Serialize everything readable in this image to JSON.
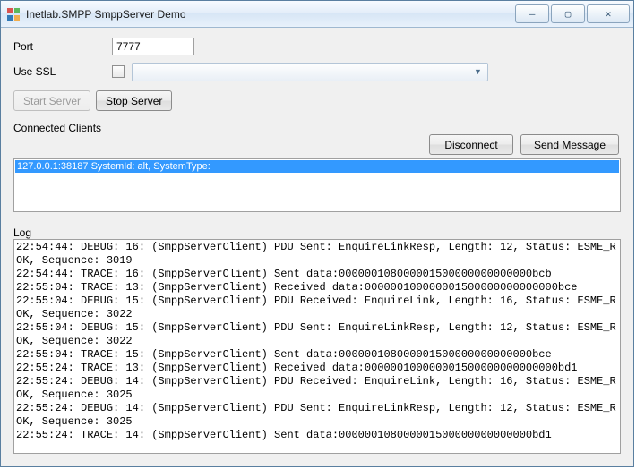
{
  "window": {
    "title": "Inetlab.SMPP SmppServer Demo"
  },
  "form": {
    "portLabel": "Port",
    "portValue": "7777",
    "sslLabel": "Use SSL",
    "sslChecked": false,
    "sslComboValue": ""
  },
  "buttons": {
    "startServer": "Start Server",
    "stopServer": "Stop Server",
    "disconnect": "Disconnect",
    "sendMessage": "Send Message"
  },
  "sections": {
    "connectedClients": "Connected Clients",
    "log": "Log"
  },
  "clients": [
    {
      "text": "127.0.0.1:38187 SystemId: alt, SystemType:",
      "selected": true
    }
  ],
  "logLines": [
    "22:54:44: DEBUG: 16: (SmppServerClient) PDU Sent: EnquireLinkResp, Length: 12, Status: ESME_ROK, Sequence: 3019",
    "22:54:44: TRACE: 16: (SmppServerClient) Sent data:000000108000001500000000000000bcb",
    "22:55:04: TRACE: 13: (SmppServerClient) Received data:000000100000001500000000000000bce",
    "22:55:04: DEBUG: 15: (SmppServerClient) PDU Received: EnquireLink, Length: 16, Status: ESME_ROK, Sequence: 3022",
    "22:55:04: DEBUG: 15: (SmppServerClient) PDU Sent: EnquireLinkResp, Length: 12, Status: ESME_ROK, Sequence: 3022",
    "22:55:04: TRACE: 15: (SmppServerClient) Sent data:000000108000001500000000000000bce",
    "22:55:24: TRACE: 13: (SmppServerClient) Received data:000000100000001500000000000000bd1",
    "22:55:24: DEBUG: 14: (SmppServerClient) PDU Received: EnquireLink, Length: 16, Status: ESME_ROK, Sequence: 3025",
    "22:55:24: DEBUG: 14: (SmppServerClient) PDU Sent: EnquireLinkResp, Length: 12, Status: ESME_ROK, Sequence: 3025",
    "22:55:24: TRACE: 14: (SmppServerClient) Sent data:000000108000001500000000000000bd1"
  ]
}
